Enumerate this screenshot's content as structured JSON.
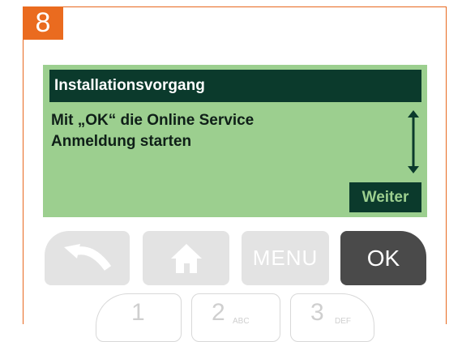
{
  "step": {
    "number": "8"
  },
  "display": {
    "title": "Installationsvorgang",
    "message_line1": "Mit „OK“ die Online Service",
    "message_line2": "Anmeldung starten",
    "softkey": "Weiter"
  },
  "keys": {
    "back_icon": "back-arrow-icon",
    "home_icon": "home-icon",
    "menu": "MENU",
    "ok": "OK"
  },
  "numpad": [
    {
      "digit": "1",
      "letters": ""
    },
    {
      "digit": "2",
      "letters": "ABC"
    },
    {
      "digit": "3",
      "letters": "DEF"
    }
  ],
  "colors": {
    "accent": "#ea6b1f",
    "lcd_background": "#9ccf8f",
    "lcd_dark": "#0b3a2c",
    "key_light": "#e3e3e3",
    "key_ok": "#4a4a4a"
  }
}
